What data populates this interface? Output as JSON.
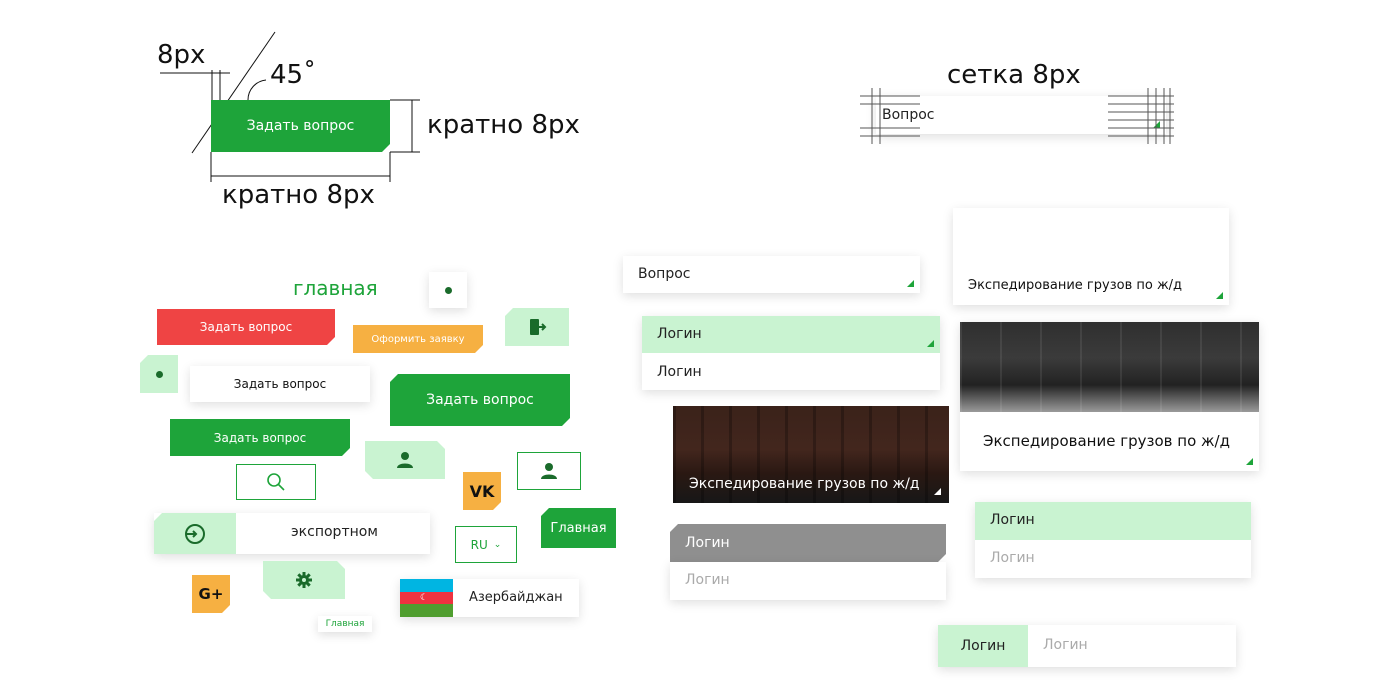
{
  "spec": {
    "px8_label": "8px",
    "angle_label": "45˚",
    "multiple_right": "кратно 8px",
    "multiple_bottom": "кратно 8px",
    "main_button": "Задать вопрос",
    "grid_title": "сетка 8px",
    "grid_field": "Вопрос"
  },
  "buttons": {
    "heading": "главная",
    "red": "Задать вопрос",
    "orange": "Оформить заявку",
    "white": "Задать вопрос",
    "green_large": "Задать вопрос",
    "green_small": "Задать вопрос",
    "search_text": "экспортном",
    "lang": "RU",
    "main_tab": "Главная",
    "country": "Азербайджан",
    "tiny_link": "Главная",
    "vk_label": "VK",
    "gplus_label": "G+"
  },
  "fields": {
    "question": "Вопрос",
    "login_active": "Логин",
    "login_value": "Логин",
    "card_text": "Экспедирование грузов по ж/д",
    "photo_card_dark": "Экспедирование грузов по ж/д",
    "photo_card_light": "Экспедирование грузов по ж/д",
    "login_gray_head": "Логин",
    "login_gray_placeholder": "Логин",
    "login_green_head": "Логин",
    "login_green_placeholder": "Логин",
    "login_inline_label": "Логин",
    "login_inline_placeholder": "Логин"
  },
  "colors": {
    "green": "#1ea43a",
    "light_green": "#c9f3d1",
    "red": "#ef4444",
    "orange": "#f6b042",
    "gray": "#8f8f8f"
  }
}
